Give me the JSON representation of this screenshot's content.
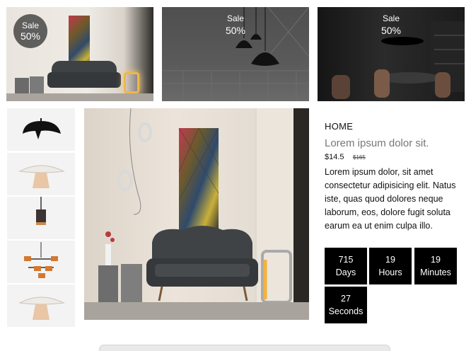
{
  "banners": [
    {
      "sale_label": "Sale",
      "sale_percent": "50%"
    },
    {
      "sale_label": "Sale",
      "sale_percent": "50%"
    },
    {
      "sale_label": "Sale",
      "sale_percent": "50%"
    }
  ],
  "thumbnails": [
    "black-dome-pendant",
    "white-mushroom-lamp",
    "cylinder-pendant",
    "multi-arm-chandelier",
    "white-mushroom-lamp"
  ],
  "product": {
    "breadcrumb": "HOME",
    "title": "Lorem ipsum dolor sit.",
    "price": "$14.5",
    "old_price": "$165",
    "description": "Lorem ipsum dolor, sit amet consectetur adipisicing elit. Natus iste, quas quod dolores neque laborum, eos, dolore fugit soluta earum ea ut enim culpa illo."
  },
  "countdown": {
    "days": {
      "value": "715",
      "label": "Days"
    },
    "hours": {
      "value": "19",
      "label": "Hours"
    },
    "minutes": {
      "value": "19",
      "label": "Minutes"
    },
    "seconds": {
      "value": "27",
      "label": "Seconds"
    }
  },
  "colors": {
    "accent": "#000000",
    "sale_badge": "#464646"
  }
}
